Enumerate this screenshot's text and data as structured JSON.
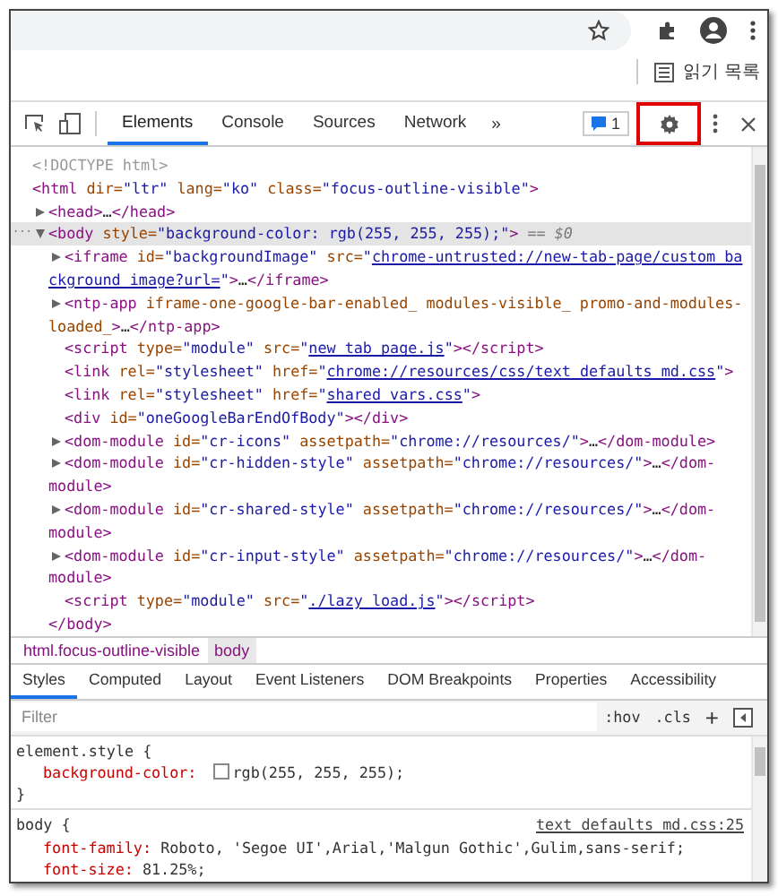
{
  "browser": {
    "reading_list": "읽기 목록"
  },
  "devtools": {
    "tabs": [
      {
        "label": "Elements",
        "selected": true
      },
      {
        "label": "Console",
        "selected": false
      },
      {
        "label": "Sources",
        "selected": false
      },
      {
        "label": "Network",
        "selected": false
      }
    ],
    "more_tabs": "»",
    "issues_count": "1",
    "settings_highlighted": true
  },
  "dom_tree": [
    {
      "tokens": [
        {
          "kind": "comment",
          "text": "<!DOCTYPE html>"
        }
      ]
    },
    {
      "tokens": [
        {
          "kind": "tag",
          "text": "<html"
        },
        {
          "kind": "attr",
          "text": " dir="
        },
        {
          "kind": "value",
          "text": "\"ltr\""
        },
        {
          "kind": "attr",
          "text": " lang="
        },
        {
          "kind": "value",
          "text": "\"ko\""
        },
        {
          "kind": "attr",
          "text": " class="
        },
        {
          "kind": "value",
          "text": "\"focus-outline-visible\""
        },
        {
          "kind": "tag",
          "text": ">"
        }
      ],
      "children": [
        {
          "expanded": false,
          "tokens": [
            {
              "kind": "tag",
              "text": "<head>"
            },
            {
              "kind": "text",
              "text": "…"
            },
            {
              "kind": "tag",
              "text": "</head>"
            }
          ]
        },
        {
          "expanded": true,
          "selected": true,
          "gutter": "···",
          "suffix": "== $0",
          "tokens": [
            {
              "kind": "tag",
              "text": "<body"
            },
            {
              "kind": "attr",
              "text": " style="
            },
            {
              "kind": "value",
              "text": "\"background-color: rgb(255, 255, 255);\""
            },
            {
              "kind": "tag",
              "text": ">"
            }
          ],
          "closing": [
            {
              "kind": "tag",
              "text": "</body>"
            }
          ],
          "children": [
            {
              "expanded": false,
              "tokens": [
                {
                  "kind": "tag",
                  "text": "<iframe"
                },
                {
                  "kind": "attr",
                  "text": " id="
                },
                {
                  "kind": "value",
                  "text": "\"backgroundImage\""
                },
                {
                  "kind": "attr",
                  "text": " src="
                },
                {
                  "kind": "value",
                  "text": "\""
                },
                {
                  "kind": "link",
                  "text": "chrome-untrusted://new-tab-page/custom_background_image?url="
                },
                {
                  "kind": "value",
                  "text": "\""
                },
                {
                  "kind": "tag",
                  "text": ">"
                },
                {
                  "kind": "text",
                  "text": "…"
                },
                {
                  "kind": "tag",
                  "text": "</iframe>"
                }
              ]
            },
            {
              "expanded": false,
              "tokens": [
                {
                  "kind": "tag",
                  "text": "<ntp-app"
                },
                {
                  "kind": "attr",
                  "text": " iframe-one-google-bar-enabled_ modules-visible_ promo-and-modules-loaded_"
                },
                {
                  "kind": "tag",
                  "text": ">"
                },
                {
                  "kind": "text",
                  "text": "…"
                },
                {
                  "kind": "tag",
                  "text": "</ntp-app>"
                }
              ]
            },
            {
              "tokens": [
                {
                  "kind": "tag",
                  "text": "<script"
                },
                {
                  "kind": "attr",
                  "text": " type="
                },
                {
                  "kind": "value",
                  "text": "\"module\""
                },
                {
                  "kind": "attr",
                  "text": " src="
                },
                {
                  "kind": "value",
                  "text": "\""
                },
                {
                  "kind": "link",
                  "text": "new_tab_page.js"
                },
                {
                  "kind": "value",
                  "text": "\""
                },
                {
                  "kind": "tag",
                  "text": "></script>"
                }
              ]
            },
            {
              "tokens": [
                {
                  "kind": "tag",
                  "text": "<link"
                },
                {
                  "kind": "attr",
                  "text": " rel="
                },
                {
                  "kind": "value",
                  "text": "\"stylesheet\""
                },
                {
                  "kind": "attr",
                  "text": " href="
                },
                {
                  "kind": "value",
                  "text": "\""
                },
                {
                  "kind": "link",
                  "text": "chrome://resources/css/text_defaults_md.css"
                },
                {
                  "kind": "value",
                  "text": "\""
                },
                {
                  "kind": "tag",
                  "text": ">"
                }
              ]
            },
            {
              "tokens": [
                {
                  "kind": "tag",
                  "text": "<link"
                },
                {
                  "kind": "attr",
                  "text": " rel="
                },
                {
                  "kind": "value",
                  "text": "\"stylesheet\""
                },
                {
                  "kind": "attr",
                  "text": " href="
                },
                {
                  "kind": "value",
                  "text": "\""
                },
                {
                  "kind": "link",
                  "text": "shared_vars.css"
                },
                {
                  "kind": "value",
                  "text": "\""
                },
                {
                  "kind": "tag",
                  "text": ">"
                }
              ]
            },
            {
              "tokens": [
                {
                  "kind": "tag",
                  "text": "<div"
                },
                {
                  "kind": "attr",
                  "text": " id="
                },
                {
                  "kind": "value",
                  "text": "\"oneGoogleBarEndOfBody\""
                },
                {
                  "kind": "tag",
                  "text": "></div>"
                }
              ]
            },
            {
              "expanded": false,
              "tokens": [
                {
                  "kind": "tag",
                  "text": "<dom-module"
                },
                {
                  "kind": "attr",
                  "text": " id="
                },
                {
                  "kind": "value",
                  "text": "\"cr-icons\""
                },
                {
                  "kind": "attr",
                  "text": " assetpath="
                },
                {
                  "kind": "value",
                  "text": "\"chrome://resources/\""
                },
                {
                  "kind": "tag",
                  "text": ">"
                },
                {
                  "kind": "text",
                  "text": "…"
                },
                {
                  "kind": "tag",
                  "text": "</dom-module>"
                }
              ]
            },
            {
              "expanded": false,
              "tokens": [
                {
                  "kind": "tag",
                  "text": "<dom-module"
                },
                {
                  "kind": "attr",
                  "text": " id="
                },
                {
                  "kind": "value",
                  "text": "\"cr-hidden-style\""
                },
                {
                  "kind": "attr",
                  "text": " assetpath="
                },
                {
                  "kind": "value",
                  "text": "\"chrome://resources/\""
                },
                {
                  "kind": "tag",
                  "text": ">"
                },
                {
                  "kind": "text",
                  "text": "…"
                },
                {
                  "kind": "tag",
                  "text": "</dom-module>"
                }
              ]
            },
            {
              "expanded": false,
              "tokens": [
                {
                  "kind": "tag",
                  "text": "<dom-module"
                },
                {
                  "kind": "attr",
                  "text": " id="
                },
                {
                  "kind": "value",
                  "text": "\"cr-shared-style\""
                },
                {
                  "kind": "attr",
                  "text": " assetpath="
                },
                {
                  "kind": "value",
                  "text": "\"chrome://resources/\""
                },
                {
                  "kind": "tag",
                  "text": ">"
                },
                {
                  "kind": "text",
                  "text": "…"
                },
                {
                  "kind": "tag",
                  "text": "</dom-module>"
                }
              ]
            },
            {
              "expanded": false,
              "tokens": [
                {
                  "kind": "tag",
                  "text": "<dom-module"
                },
                {
                  "kind": "attr",
                  "text": " id="
                },
                {
                  "kind": "value",
                  "text": "\"cr-input-style\""
                },
                {
                  "kind": "attr",
                  "text": " assetpath="
                },
                {
                  "kind": "value",
                  "text": "\"chrome://resources/\""
                },
                {
                  "kind": "tag",
                  "text": ">"
                },
                {
                  "kind": "text",
                  "text": "…"
                },
                {
                  "kind": "tag",
                  "text": "</dom-module>"
                }
              ]
            },
            {
              "tokens": [
                {
                  "kind": "tag",
                  "text": "<script"
                },
                {
                  "kind": "attr",
                  "text": " type="
                },
                {
                  "kind": "value",
                  "text": "\"module\""
                },
                {
                  "kind": "attr",
                  "text": " src="
                },
                {
                  "kind": "value",
                  "text": "\""
                },
                {
                  "kind": "link",
                  "text": "./lazy_load.js"
                },
                {
                  "kind": "value",
                  "text": "\""
                },
                {
                  "kind": "tag",
                  "text": "></script>"
                }
              ]
            }
          ]
        }
      ]
    }
  ],
  "breadcrumbs": [
    {
      "label": "html.focus-outline-visible",
      "selected": false
    },
    {
      "label": "body",
      "selected": true
    }
  ],
  "styles_tabs": [
    {
      "label": "Styles",
      "selected": true
    },
    {
      "label": "Computed",
      "selected": false
    },
    {
      "label": "Layout",
      "selected": false
    },
    {
      "label": "Event Listeners",
      "selected": false
    },
    {
      "label": "DOM Breakpoints",
      "selected": false
    },
    {
      "label": "Properties",
      "selected": false
    },
    {
      "label": "Accessibility",
      "selected": false
    }
  ],
  "filter": {
    "placeholder": "Filter",
    "buttons": [
      ":hov",
      ".cls",
      "+"
    ]
  },
  "rules": [
    {
      "selector": "element.style {",
      "declarations": [
        {
          "property": "background-color:",
          "value": "rgb(255, 255, 255);",
          "color": "#ffffff"
        }
      ],
      "close": "}"
    },
    {
      "selector": "body {",
      "source": "text_defaults_md.css:25",
      "declarations": [
        {
          "property": "font-family:",
          "value": "Roboto, 'Segoe UI',Arial,'Malgun Gothic',Gulim,sans-serif;"
        },
        {
          "property": "font-size:",
          "value": "81.25%;"
        }
      ]
    }
  ]
}
